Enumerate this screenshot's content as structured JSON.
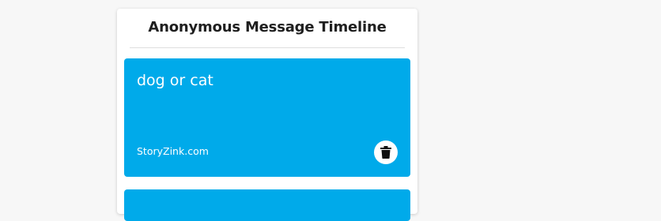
{
  "timeline": {
    "title": "Anonymous Message Timeline",
    "messages": [
      {
        "text": "dog or cat",
        "footer": "StoryZink.com",
        "delete_icon": "trash-icon",
        "color": "#00aaea"
      },
      {
        "text": "",
        "footer": "",
        "color": "#00aaea"
      }
    ]
  }
}
